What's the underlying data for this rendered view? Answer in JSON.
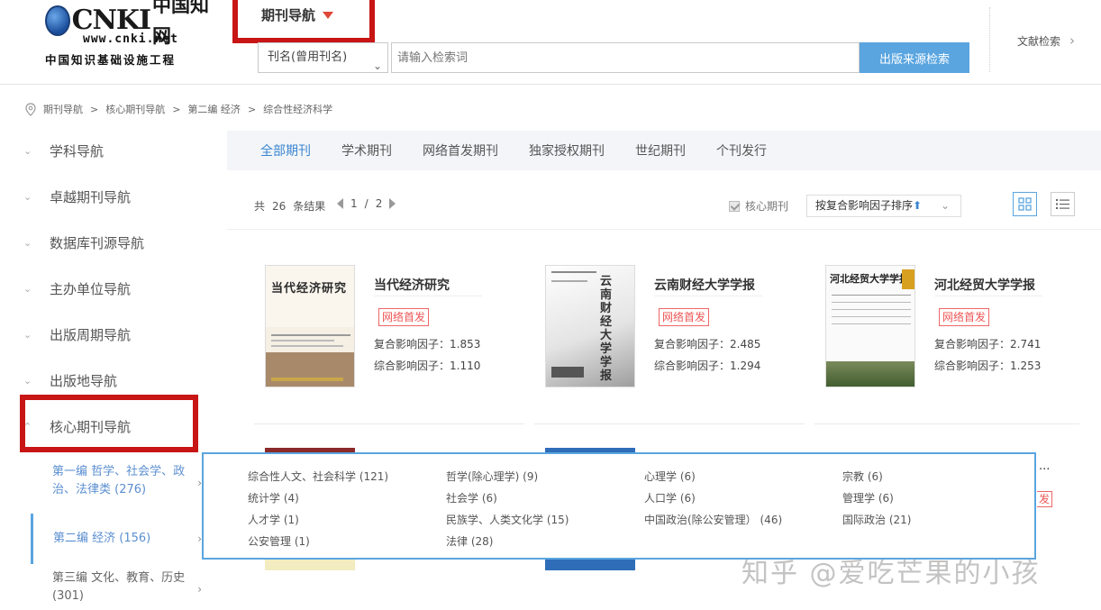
{
  "header": {
    "logo_cnki": "CNKI",
    "logo_cn": "中国知网",
    "logo_url": "www.cnki.net",
    "logo_sub": "中国知识基础设施工程",
    "nav_label": "期刊导航",
    "search_field": "刊名(曾用刊名)",
    "search_placeholder": "请输入检索词",
    "search_button": "出版来源检索",
    "doc_search": "文献检索"
  },
  "breadcrumb": [
    "期刊导航",
    "核心期刊导航",
    "第二编 经济",
    "综合性经济科学"
  ],
  "breadcrumb_sep": ">",
  "sidebar": {
    "items": [
      "学科导航",
      "卓越期刊导航",
      "数据库刊源导航",
      "主办单位导航",
      "出版周期导航",
      "出版地导航",
      "核心期刊导航"
    ],
    "sub_items": [
      "第一编 哲学、社会学、政治、法律类 (276)",
      "第二编 经济 (156)",
      "第三编 文化、教育、历史 (301)"
    ]
  },
  "tabs": [
    "全部期刊",
    "学术期刊",
    "网络首发期刊",
    "独家授权期刊",
    "世纪期刊",
    "个刊发行"
  ],
  "toolbar": {
    "count_prefix": "共",
    "count": "26",
    "count_suffix": "条结果",
    "page_current": "1",
    "page_sep": "/",
    "page_total": "2",
    "core_label": "核心期刊",
    "sort_label": "按复合影响因子排序",
    "sort_arrow": "⬆"
  },
  "journals": [
    {
      "title": "当代经济研究",
      "badge": "网络首发",
      "composite": "复合影响因子：1.853",
      "comprehensive": "综合影响因子：1.110",
      "cover_text": "当代经济研究"
    },
    {
      "title": "云南财经大学学报",
      "badge": "网络首发",
      "composite": "复合影响因子：2.485",
      "comprehensive": "综合影响因子：1.294",
      "cover_text": "云南财经大学学报"
    },
    {
      "title": "河北经贸大学学报",
      "badge": "网络首发",
      "composite": "复合影响因子：2.741",
      "comprehensive": "综合影响因子：1.253",
      "cover_text": "河北经贸大学学报"
    }
  ],
  "popup": {
    "items": [
      "综合性人文、社会科学 (121)",
      "哲学(除心理学) (9)",
      "心理学 (6)",
      "宗教 (6)",
      "统计学 (4)",
      "社会学 (6)",
      "人口学 (6)",
      "管理学 (6)",
      "人才学 (1)",
      "民族学、人类文化学 (15)",
      "中国政治(除公安管理） (46)",
      "国际政治 (21)",
      "公安管理 (1)",
      "法律 (28)"
    ]
  },
  "partial": {
    "ellipsis": "...",
    "badge_fragment": "发"
  },
  "watermark": "知乎 @爱吃芒果的小孩",
  "colors": {
    "accent": "#5aa5e0",
    "highlight": "#c81515",
    "badge": "#e55555"
  }
}
